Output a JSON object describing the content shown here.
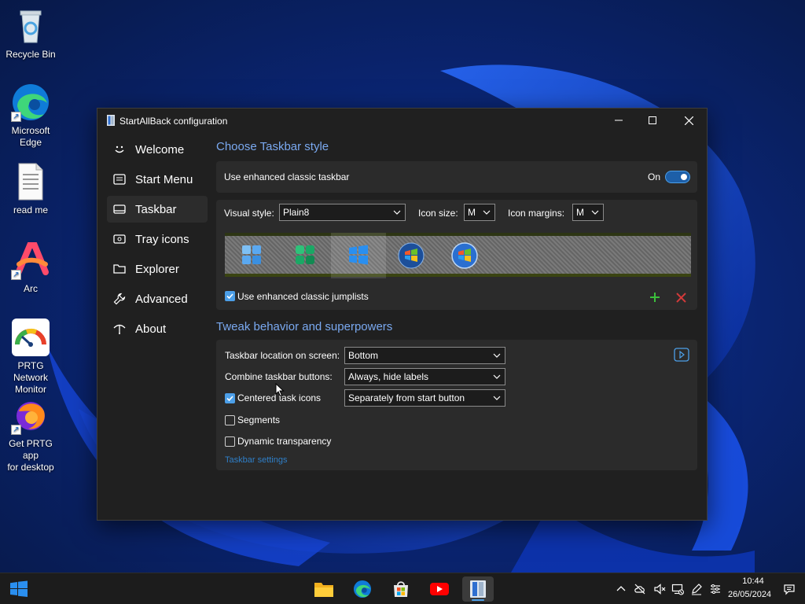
{
  "desktop": {
    "icons": [
      {
        "label": "Recycle Bin"
      },
      {
        "label": "Microsoft\nEdge"
      },
      {
        "label": "read me"
      },
      {
        "label": "Arc"
      },
      {
        "label": "PRTG Network\nMonitor"
      },
      {
        "label": "Get PRTG app\nfor desktop"
      }
    ]
  },
  "window": {
    "title": "StartAllBack configuration",
    "sidebar": [
      {
        "label": "Welcome"
      },
      {
        "label": "Start Menu"
      },
      {
        "label": "Taskbar"
      },
      {
        "label": "Tray icons"
      },
      {
        "label": "Explorer"
      },
      {
        "label": "Advanced"
      },
      {
        "label": "About"
      }
    ],
    "style_section": {
      "heading": "Choose Taskbar style",
      "enhanced_label": "Use enhanced classic taskbar",
      "enhanced_state": "On",
      "visual_style_label": "Visual style:",
      "visual_style_value": "Plain8",
      "icon_size_label": "Icon size:",
      "icon_size_value": "M",
      "icon_margins_label": "Icon margins:",
      "icon_margins_value": "M",
      "jumplists_label": "Use enhanced classic jumplists",
      "jumplists_checked": true
    },
    "behavior_section": {
      "heading": "Tweak behavior and superpowers",
      "location_label": "Taskbar location on screen:",
      "location_value": "Bottom",
      "combine_label": "Combine taskbar buttons:",
      "combine_value": "Always, hide labels",
      "centered_label": "Centered task icons",
      "centered_checked": true,
      "centered_value": "Separately from start button",
      "segments_label": "Segments",
      "segments_checked": false,
      "dynamic_label": "Dynamic transparency",
      "dynamic_checked": false,
      "settings_link": "Taskbar settings"
    }
  },
  "taskbar": {
    "clock_time": "10:44",
    "clock_date": "26/05/2024"
  },
  "colors": {
    "accent": "#4c9fe8",
    "heading": "#7aa9f0",
    "window_bg": "#202020",
    "card_bg": "#2b2b2b"
  }
}
